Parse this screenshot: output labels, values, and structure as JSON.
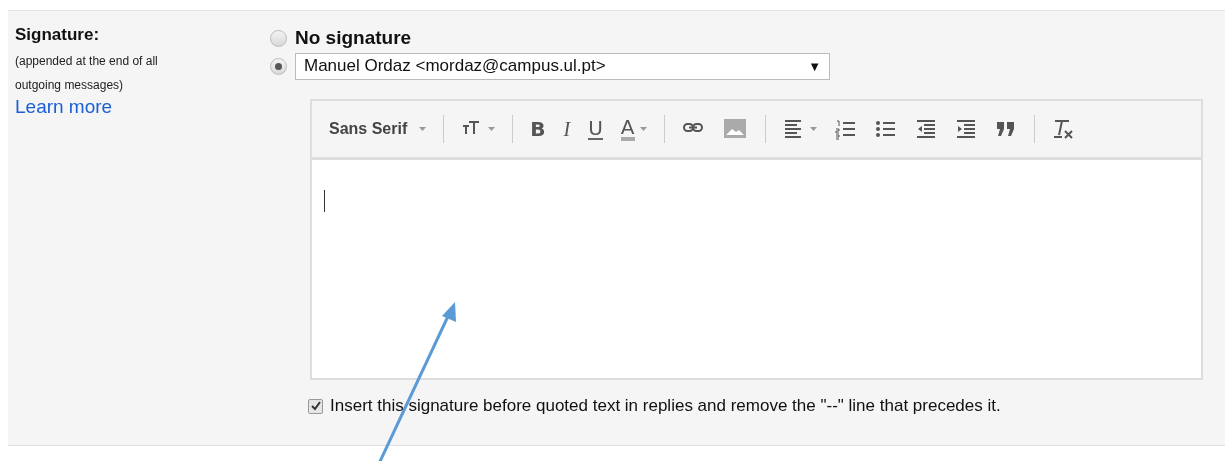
{
  "setting": {
    "label": "Signature:",
    "description": "(appended at the end of all outgoing messages)",
    "link": "Learn more"
  },
  "options": [
    {
      "kind": "plain",
      "label": "No signature",
      "selected": false
    },
    {
      "kind": "dropdown",
      "value": "Manuel Ordaz <mordaz@campus.ul.pt>",
      "caret": "▼",
      "selected": true
    }
  ],
  "toolbar": [
    {
      "kind": "font",
      "label": "Sans Serif"
    },
    {
      "kind": "sep"
    },
    {
      "kind": "size"
    },
    {
      "kind": "sep"
    },
    {
      "kind": "bold",
      "glyph": "B"
    },
    {
      "kind": "italic",
      "glyph": "I"
    },
    {
      "kind": "underline",
      "glyph": "U"
    },
    {
      "kind": "color",
      "glyph": "A"
    },
    {
      "kind": "sep"
    },
    {
      "kind": "link"
    },
    {
      "kind": "image"
    },
    {
      "kind": "sep"
    },
    {
      "kind": "align"
    },
    {
      "kind": "numbered"
    },
    {
      "kind": "bulleted"
    },
    {
      "kind": "outdent"
    },
    {
      "kind": "indent"
    },
    {
      "kind": "quote"
    },
    {
      "kind": "sep"
    },
    {
      "kind": "clear"
    }
  ],
  "checkbox": {
    "label": "Insert this signature before quoted text in replies and remove the \"--\" line that precedes it.",
    "checked": true
  }
}
